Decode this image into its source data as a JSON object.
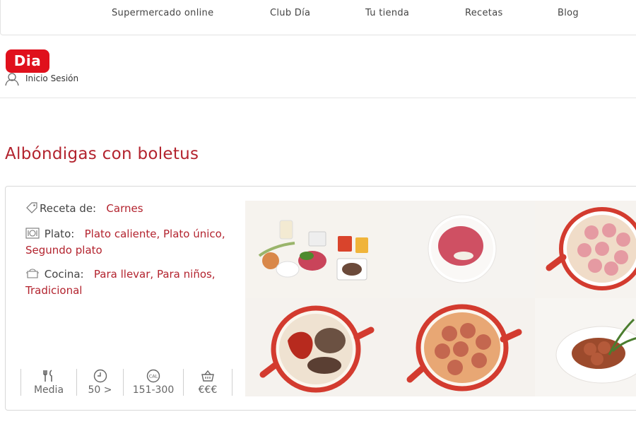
{
  "nav": {
    "items": [
      {
        "label": "Supermercado online"
      },
      {
        "label": "Club Día"
      },
      {
        "label": "Tu tienda"
      },
      {
        "label": "Recetas"
      },
      {
        "label": "Blog"
      }
    ]
  },
  "header": {
    "logo_text": "Dia",
    "login_label": "Inicio Sesión",
    "login_icon": "user-icon"
  },
  "recipe": {
    "title": "Albóndigas con boletus",
    "meta": {
      "receta_label": "Receta de:",
      "receta_value": "Carnes",
      "plato_label": "Plato:",
      "plato_value": "Plato caliente, Plato único, Segundo plato",
      "cocina_label": "Cocina:",
      "cocina_value": "Para llevar, Para niños, Tradicional"
    },
    "stats": [
      {
        "icon": "cutlery-icon",
        "value": "Media"
      },
      {
        "icon": "clock-icon",
        "value": "50 >"
      },
      {
        "icon": "calories-icon",
        "value": "151-300"
      },
      {
        "icon": "basket-icon",
        "value": "€€€"
      }
    ],
    "photos": [
      {
        "name": "ingredients-photo"
      },
      {
        "name": "minced-meat-bowl-photo"
      },
      {
        "name": "meatballs-pan-photo"
      },
      {
        "name": "sauce-pan-photo"
      },
      {
        "name": "meatballs-sauce-photo"
      },
      {
        "name": "plated-dish-photo"
      }
    ]
  },
  "colors": {
    "brand_red": "#e0101c",
    "accent_red": "#b3232e"
  }
}
